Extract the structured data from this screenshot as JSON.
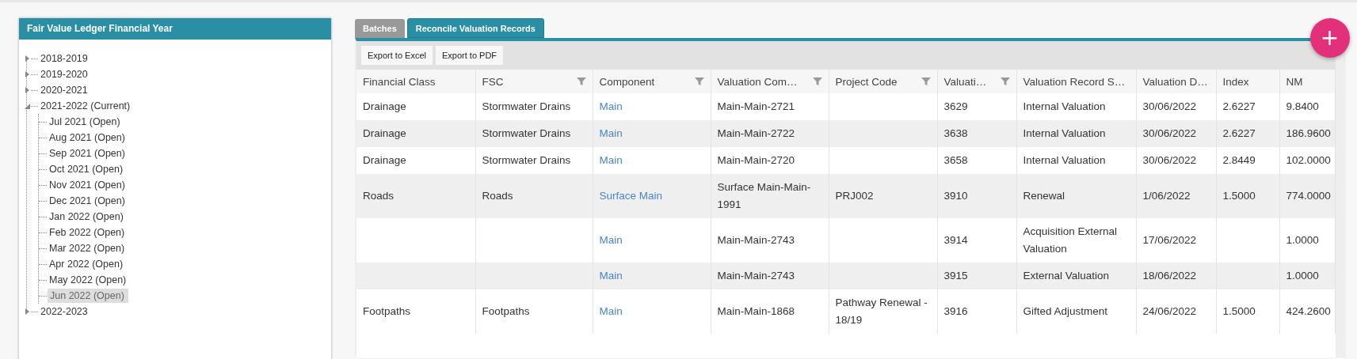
{
  "tree_panel": {
    "title": "Fair Value Ledger Financial Year",
    "items": [
      {
        "label": "2018-2019",
        "expanded": false,
        "selected": false
      },
      {
        "label": "2019-2020",
        "expanded": false,
        "selected": false
      },
      {
        "label": "2020-2021",
        "expanded": false,
        "selected": false
      },
      {
        "label": "2021-2022 (Current)",
        "expanded": true,
        "selected": false,
        "children": [
          {
            "label": "Jul 2021 (Open)",
            "selected": false
          },
          {
            "label": "Aug 2021 (Open)",
            "selected": false
          },
          {
            "label": "Sep 2021 (Open)",
            "selected": false
          },
          {
            "label": "Oct 2021 (Open)",
            "selected": false
          },
          {
            "label": "Nov 2021 (Open)",
            "selected": false
          },
          {
            "label": "Dec 2021 (Open)",
            "selected": false
          },
          {
            "label": "Jan 2022 (Open)",
            "selected": false
          },
          {
            "label": "Feb 2022 (Open)",
            "selected": false
          },
          {
            "label": "Mar 2022 (Open)",
            "selected": false
          },
          {
            "label": "Apr 2022 (Open)",
            "selected": false
          },
          {
            "label": "May 2022 (Open)",
            "selected": false
          },
          {
            "label": "Jun 2022 (Open)",
            "selected": true
          }
        ]
      },
      {
        "label": "2022-2023",
        "expanded": false,
        "selected": false
      }
    ]
  },
  "tabs": [
    {
      "label": "Batches",
      "selected": false
    },
    {
      "label": "Reconcile Valuation Records",
      "selected": true
    }
  ],
  "toolbar": {
    "buttons": [
      "Export to Excel",
      "Export to PDF"
    ]
  },
  "add_button": {
    "label": "+"
  },
  "table": {
    "columns": [
      {
        "label": "Financial Class",
        "filter": false,
        "kind": "text"
      },
      {
        "label": "FSC",
        "filter": true,
        "kind": "text"
      },
      {
        "label": "Component",
        "filter": true,
        "kind": "link"
      },
      {
        "label": "Valuation Com…",
        "filter": true,
        "kind": "text"
      },
      {
        "label": "Project Code",
        "filter": true,
        "kind": "text"
      },
      {
        "label": "Valuati…",
        "filter": true,
        "kind": "text"
      },
      {
        "label": "Valuation Record S…",
        "filter": false,
        "kind": "text"
      },
      {
        "label": "Valuation D…",
        "filter": false,
        "kind": "text"
      },
      {
        "label": "Index",
        "filter": false,
        "kind": "text"
      },
      {
        "label": "NM",
        "filter": false,
        "kind": "text"
      }
    ],
    "rows": [
      [
        "Drainage",
        "Stormwater Drains",
        "Main",
        "Main-Main-2721",
        "",
        "3629",
        "Internal Valuation",
        "30/06/2022",
        "2.6227",
        "9.8400"
      ],
      [
        "Drainage",
        "Stormwater Drains",
        "Main",
        "Main-Main-2722",
        "",
        "3638",
        "Internal Valuation",
        "30/06/2022",
        "2.6227",
        "186.9600"
      ],
      [
        "Drainage",
        "Stormwater Drains",
        "Main",
        "Main-Main-2720",
        "",
        "3658",
        "Internal Valuation",
        "30/06/2022",
        "2.8449",
        "102.0000"
      ],
      [
        "Roads",
        "Roads",
        "Surface Main",
        "Surface Main-Main-1991",
        "PRJ002",
        "3910",
        "Renewal",
        "1/06/2022",
        "1.5000",
        "774.0000"
      ],
      [
        "",
        "",
        "Main",
        "Main-Main-2743",
        "",
        "3914",
        "Acquisition External Valuation",
        "17/06/2022",
        "",
        "1.0000"
      ],
      [
        "",
        "",
        "Main",
        "Main-Main-2743",
        "",
        "3915",
        "External Valuation",
        "18/06/2022",
        "",
        "1.0000"
      ],
      [
        "Footpaths",
        "Footpaths",
        "Main",
        "Main-Main-1868",
        "Pathway Renewal - 18/19",
        "3916",
        "Gifted Adjustment",
        "24/06/2022",
        "1.5000",
        "424.2600"
      ]
    ]
  }
}
